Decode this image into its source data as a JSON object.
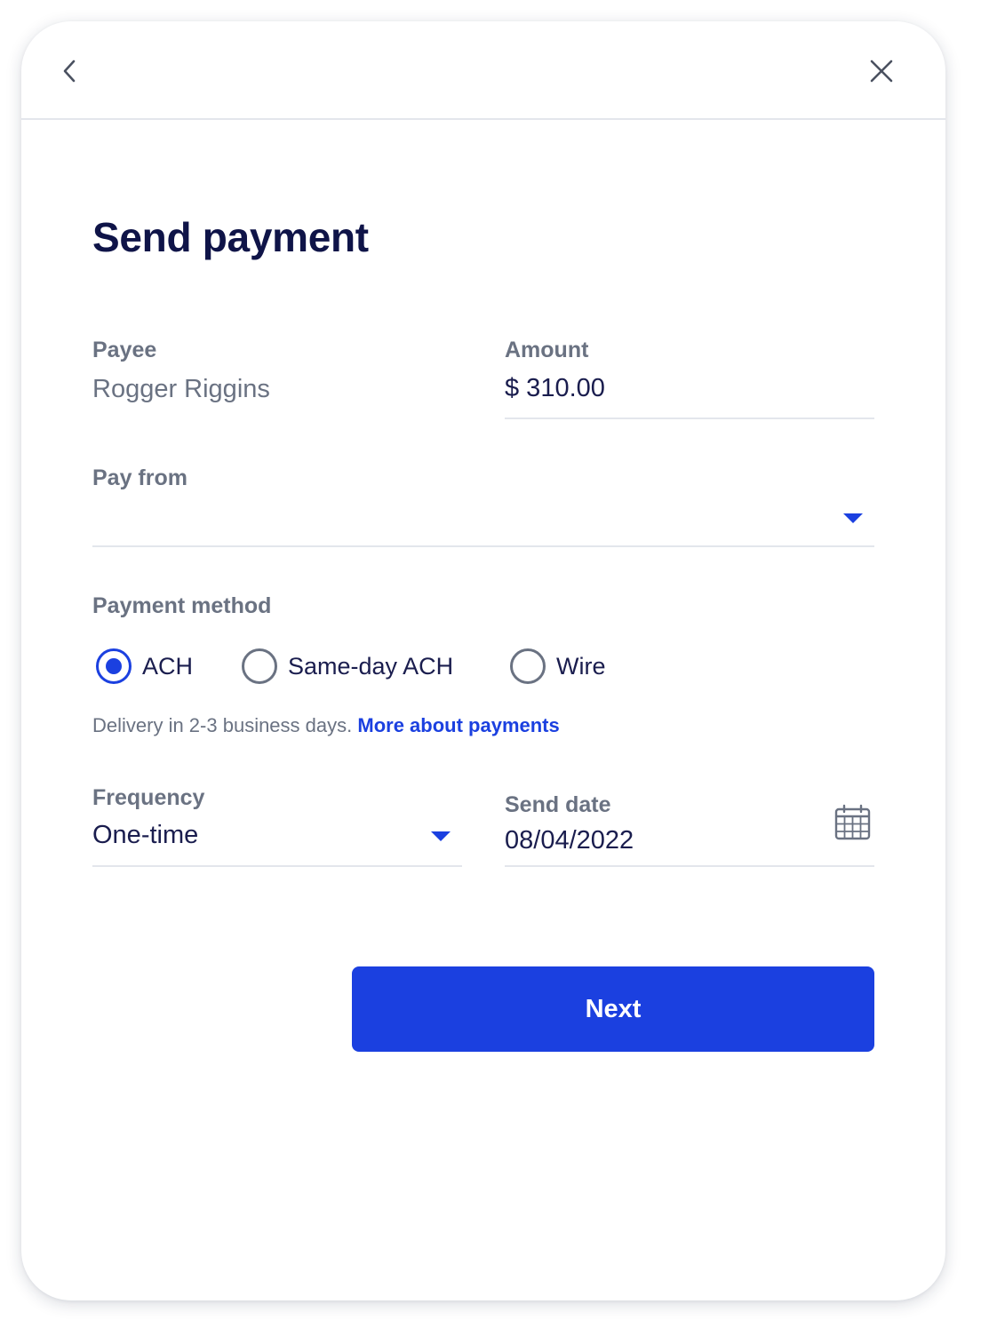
{
  "header": {
    "back_icon": "chevron-left-icon",
    "close_icon": "close-icon"
  },
  "title": "Send payment",
  "payee": {
    "label": "Payee",
    "value": "Rogger Riggins"
  },
  "amount": {
    "label": "Amount",
    "value": "$ 310.00"
  },
  "pay_from": {
    "label": "Pay from",
    "value": "",
    "icon": "caret-down-icon"
  },
  "payment_method": {
    "label": "Payment method",
    "options": [
      {
        "label": "ACH",
        "checked": true
      },
      {
        "label": "Same-day ACH",
        "checked": false
      },
      {
        "label": "Wire",
        "checked": false
      }
    ],
    "hint": "Delivery in 2-3 business days.",
    "link": "More about payments"
  },
  "frequency": {
    "label": "Frequency",
    "value": "One-time",
    "icon": "caret-down-icon"
  },
  "send_date": {
    "label": "Send date",
    "value": "08/04/2022",
    "icon": "calendar-icon"
  },
  "next_button": "Next",
  "colors": {
    "accent": "#1b40e0",
    "title": "#0f1448",
    "label": "#6a7282",
    "divider": "#e3e6ec"
  }
}
